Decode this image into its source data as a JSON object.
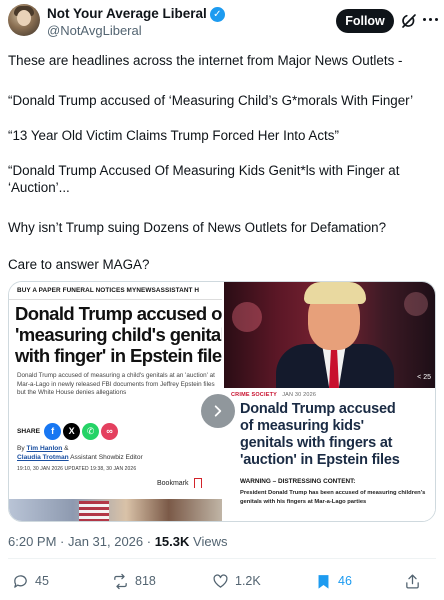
{
  "author": {
    "display_name": "Not Your Average Liberal",
    "handle": "@NotAvgLiberal",
    "verified_icon": "verified-badge-icon",
    "verified_mark": "✓"
  },
  "header": {
    "follow_label": "Follow",
    "grok_icon": "grok-icon",
    "more_icon": "more-options-icon"
  },
  "tweet": {
    "lines": [
      "These are headlines across the internet from Major News Outlets -",
      "“Donald Trump accused of ‘Measuring Child’s G*morals With Finger’",
      "“13 Year Old Victim Claims Trump Forced Her Into Acts”",
      "“Donald Trump Accused Of Measuring Kids Genit*ls with Finger at",
      "‘Auction’...",
      "Why isn’t Trump suing Dozens of News Outlets for Defamation?",
      "Care to answer MAGA?"
    ]
  },
  "media": {
    "left": {
      "nav": "BUY A PAPER    FUNERAL NOTICES    MYNEWSASSISTANT    H",
      "headline": [
        "Donald Trump accused of",
        "'measuring child's genitals",
        "with finger' in Epstein files"
      ],
      "body": "Donald Trump accused of measuring a child's genitals at an 'auction' at Mar-a-Lago in newly released FBI documents from Jeffrey Epstein files but the White House denies allegations",
      "share_label": "SHARE",
      "share_icons": [
        {
          "label": "f",
          "color": "#1877f2",
          "icon": "facebook-icon"
        },
        {
          "label": "X",
          "color": "#000000",
          "icon": "x-icon"
        },
        {
          "label": "✆",
          "color": "#25d366",
          "icon": "whatsapp-icon"
        },
        {
          "label": "∞",
          "color": "#e4405f",
          "icon": "link-icon"
        }
      ],
      "by": "By",
      "author1": "Tim Hanlon",
      "amp": "&",
      "author2": "Claudia Trotman",
      "author_role": "Assistant Showbiz Editor",
      "dates": "19:10, 30 JAN 2026      UPDATED 19:38, 30 JAN 2026",
      "bookmark_label": "Bookmark"
    },
    "right": {
      "photo_count": "< 25",
      "tag": "CRIME SOCIETY",
      "tag_date": "JAN 30 2026",
      "headline": [
        "Donald Trump accused",
        "of measuring kids'",
        "genitals with fingers at",
        "'auction' in Epstein files"
      ],
      "warning": "WARNING – DISTRESSING CONTENT:",
      "body": "President Donald Trump has been accused of measuring children's genitals with his fingers at Mar-a-Lago parties"
    },
    "arrow_icon": "chevron-right-icon"
  },
  "meta": {
    "time": "6:20 PM · Jan 31, 2026 · ",
    "views_count": "15.3K",
    "views_label": " Views"
  },
  "actions": {
    "reply": {
      "count": "45",
      "icon": "reply-icon"
    },
    "repost": {
      "count": "818",
      "icon": "repost-icon"
    },
    "like": {
      "count": "1.2K",
      "icon": "heart-icon"
    },
    "bookmark": {
      "count": "46",
      "icon": "bookmark-icon"
    },
    "share": {
      "icon": "share-icon"
    }
  },
  "colors": {
    "accent": "#1d9bf0",
    "text": "#0f1419",
    "muted": "#536471"
  }
}
